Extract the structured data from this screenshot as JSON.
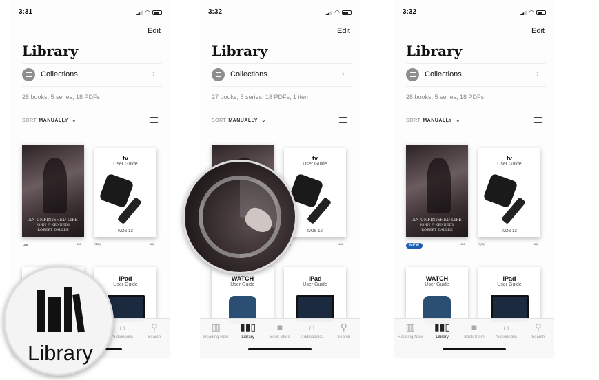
{
  "panels": [
    {
      "time": "3:31",
      "edit": "Edit",
      "title": "Library",
      "collections": "Collections",
      "count": "28 books, 5 series, 18 PDFs",
      "sort_label": "SORT",
      "sort_value": "MANUALLY",
      "book1_status": "cloud-icon",
      "new_badge": ""
    },
    {
      "time": "3:32",
      "edit": "Edit",
      "title": "Library",
      "collections": "Collections",
      "count": "27 books, 5 series, 18 PDFs, 1 item",
      "sort_label": "SORT",
      "sort_value": "MANUALLY",
      "book1_status": "downloading",
      "new_badge": ""
    },
    {
      "time": "3:32",
      "edit": "Edit",
      "title": "Library",
      "collections": "Collections",
      "count": "28 books, 5 series, 18 PDFs",
      "sort_label": "SORT",
      "sort_value": "MANUALLY",
      "book1_status": "new",
      "new_badge": "NEW"
    }
  ],
  "books": {
    "jfk_title": "AN UNFINISHED LIFE",
    "jfk_sub": "JOHN F. KENNEDY",
    "jfk_author": "ROBERT DALLEK",
    "tv_brand": "tv",
    "tv_guide": "User Guide",
    "tv_os": "tvOS 12",
    "tv_progress": "3%",
    "watch_brand": "WATCH",
    "watch_guide": "User Guide",
    "ipad_brand": "iPad",
    "ipad_guide": "User Guide",
    "more": "•••"
  },
  "tabs": [
    {
      "label": "Reading Now",
      "icon": "book-open-icon"
    },
    {
      "label": "Library",
      "icon": "library-icon"
    },
    {
      "label": "Book Store",
      "icon": "bag-icon"
    },
    {
      "label": "Audiobooks",
      "icon": "headphones-icon"
    },
    {
      "label": "Search",
      "icon": "search-icon"
    }
  ],
  "magnifier": {
    "label": "Library"
  }
}
